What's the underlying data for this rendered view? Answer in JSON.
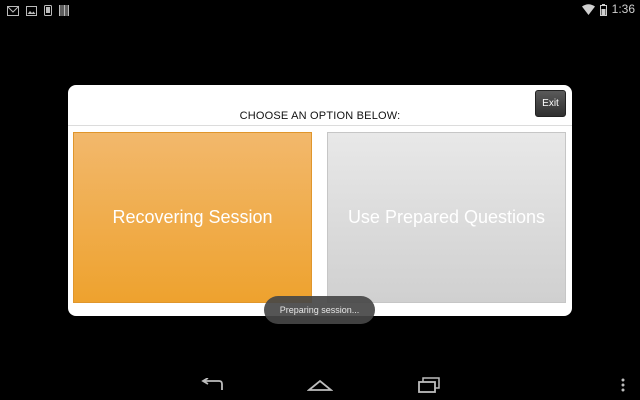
{
  "status_bar": {
    "left_icons": [
      "gmail-icon",
      "image-icon",
      "phone-icon",
      "barcode-icon"
    ],
    "right_icons": [
      "wifi-icon",
      "battery-icon"
    ],
    "time": "1:36"
  },
  "dialog": {
    "title": "CHOOSE AN OPTION BELOW:",
    "exit_label": "Exit",
    "options": [
      {
        "label": "Recovering Session",
        "color": "#efa633"
      },
      {
        "label": "Use Prepared Questions",
        "color": "#dcdcdc"
      }
    ]
  },
  "toast": {
    "text": "Preparing session..."
  },
  "nav_bar": {
    "icons": [
      "back-icon",
      "home-icon",
      "recent-apps-icon",
      "menu-icon"
    ]
  }
}
